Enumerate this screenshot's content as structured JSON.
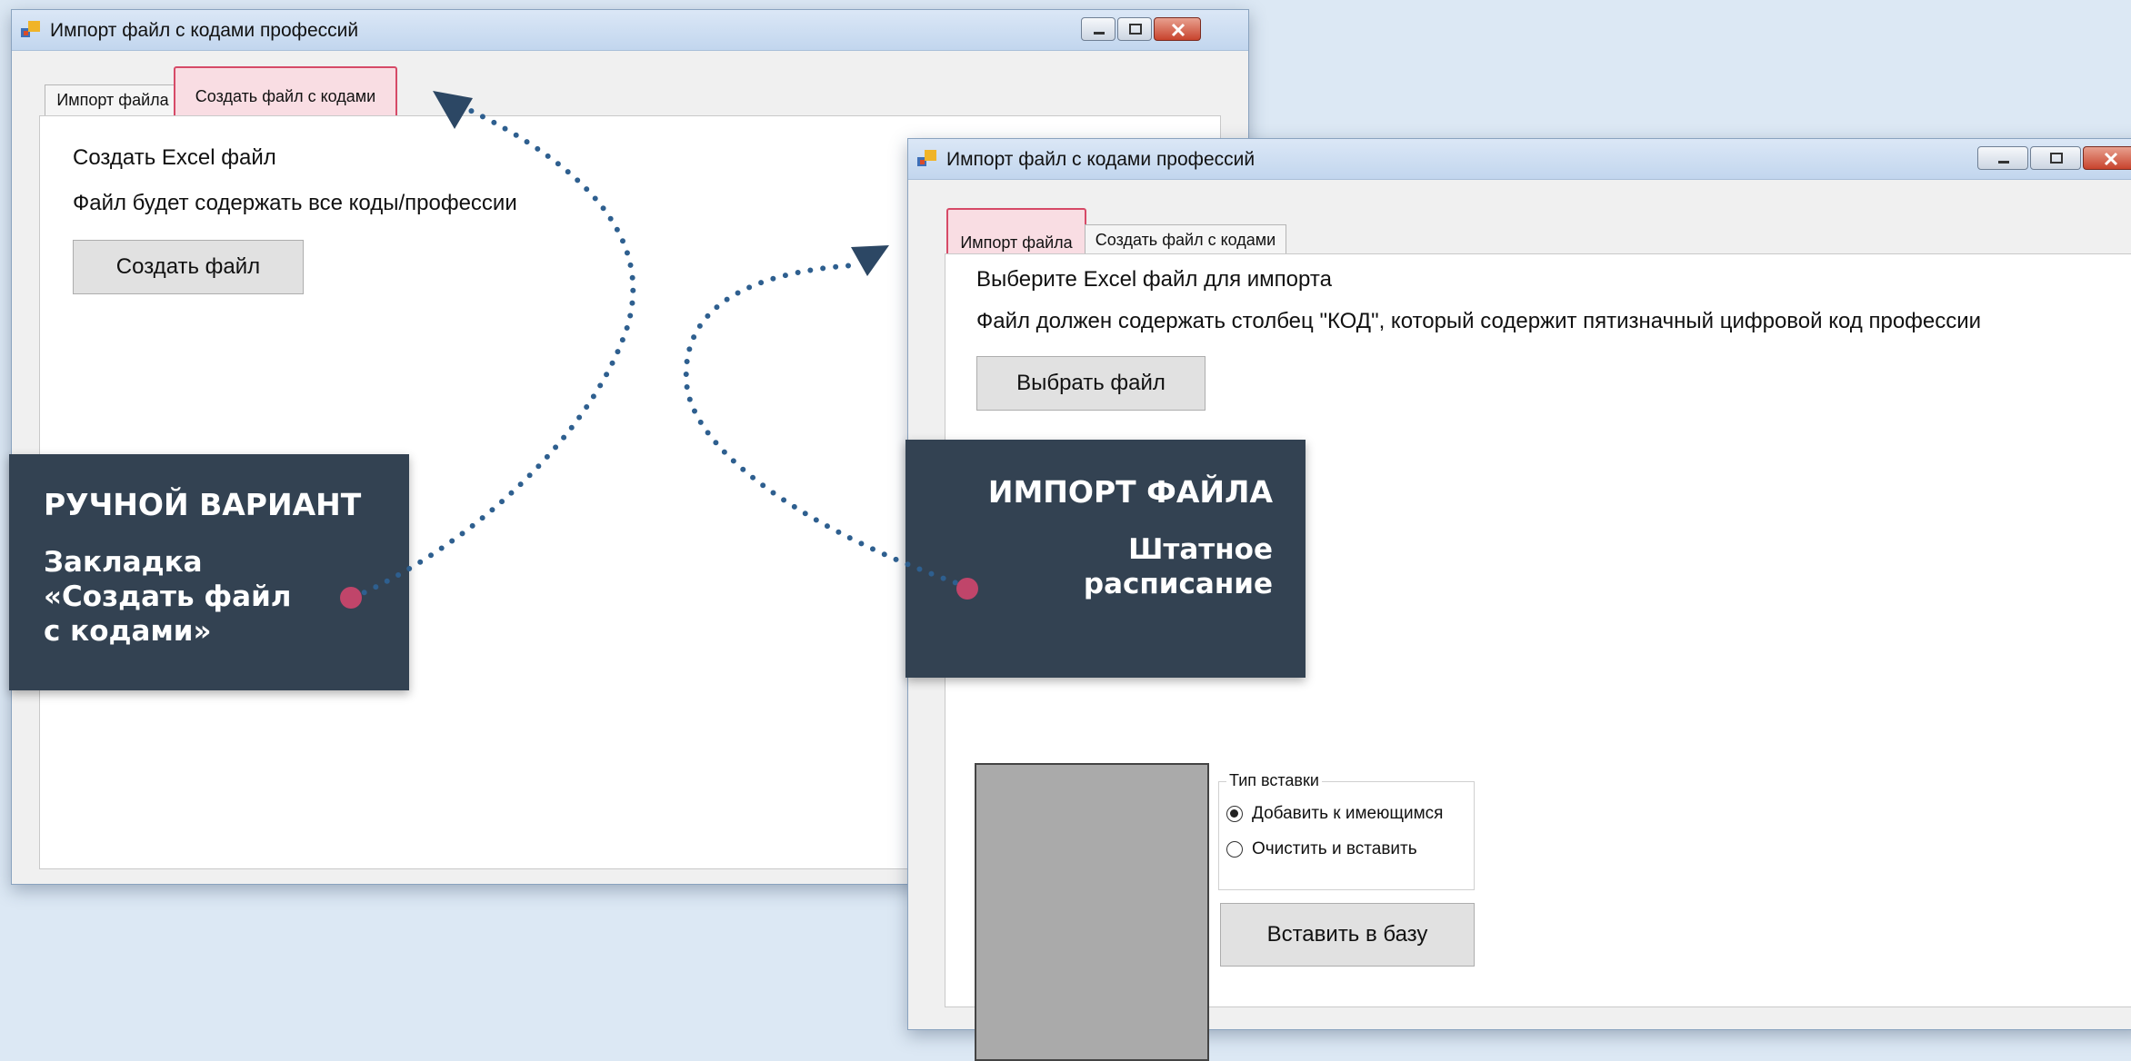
{
  "back_window": {
    "title": "Импорт файл с кодами профессий",
    "tabs": [
      {
        "label": "Импорт файла",
        "highlighted": false
      },
      {
        "label": "Создать файл с кодами",
        "highlighted": true
      }
    ],
    "heading": "Создать Excel файл",
    "description": "Файл будет содержать все коды/профессии",
    "create_button": "Создать файл"
  },
  "front_window": {
    "title": "Импорт файл с кодами профессий",
    "tabs": [
      {
        "label": "Импорт файла",
        "highlighted": true
      },
      {
        "label": "Создать файл с кодами",
        "highlighted": false
      }
    ],
    "heading": "Выберите Excel файл для импорта",
    "description": "Файл должен содержать столбец \"КОД\", который содержит пятизначный цифровой код профессии",
    "choose_button": "Выбрать файл",
    "insert_type": {
      "legend": "Тип вставки",
      "options": [
        {
          "label": "Добавить к имеющимся",
          "checked": true
        },
        {
          "label": "Очистить и вставить",
          "checked": false
        }
      ]
    },
    "insert_button": "Вставить в базу"
  },
  "callouts": {
    "manual": {
      "heading": "РУЧНОЙ ВАРИАНТ",
      "lines": [
        "Закладка",
        "«Создать файл",
        "с кодами»"
      ]
    },
    "import": {
      "heading": "ИМПОРТ ФАЙЛА",
      "lines": [
        "Штатное",
        "расписание"
      ]
    }
  },
  "colors": {
    "callout_bg": "#334252",
    "tab_highlight": "#d64a67",
    "dotted_arrow": "#2e5f8f",
    "dot_marker": "#c0456a"
  }
}
